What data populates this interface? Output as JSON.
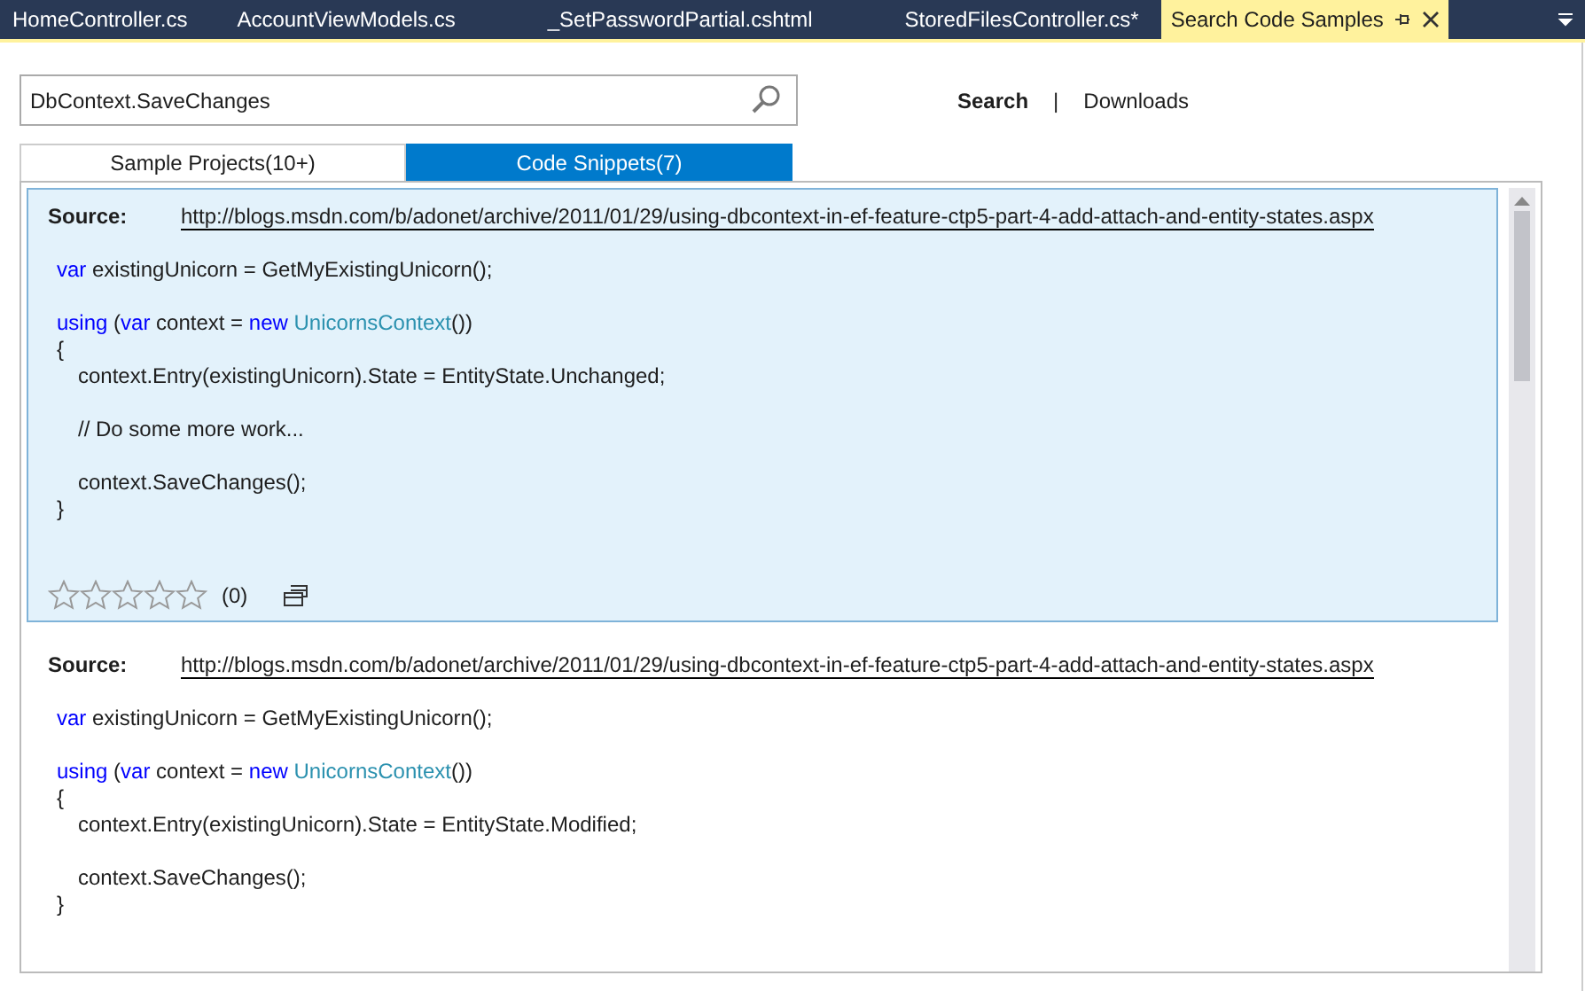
{
  "document_tabs": [
    {
      "label": "HomeController.cs",
      "selected": false
    },
    {
      "label": "AccountViewModels.cs",
      "selected": false
    },
    {
      "label": "_SetPasswordPartial.cshtml",
      "selected": false
    },
    {
      "label": "StoredFilesController.cs*",
      "selected": false
    },
    {
      "label": "Search Code Samples",
      "selected": true
    }
  ],
  "search": {
    "value": "DbContext.SaveChanges"
  },
  "nav_links": [
    {
      "label": "Search",
      "selected": true
    },
    {
      "label": "Downloads",
      "selected": false
    }
  ],
  "nav_separator": "|",
  "result_tabs": [
    {
      "label": "Sample Projects(10+)",
      "selected": false
    },
    {
      "label": "Code Snippets(7)",
      "selected": true
    }
  ],
  "snippets": [
    {
      "selected": true,
      "source_label": "Source:",
      "source_url": "http://blogs.msdn.com/b/adonet/archive/2011/01/29/using-dbcontext-in-ef-feature-ctp5-part-4-add-attach-and-entity-states.aspx",
      "stars": 0,
      "rating_count": "(0)",
      "code_blocks": [
        [
          {
            "tokens": [
              {
                "kind": "keyword",
                "text": "var"
              },
              {
                "kind": "plain",
                "text": " existingUnicorn = GetMyExistingUnicorn();"
              }
            ]
          }
        ],
        [
          {
            "tokens": [
              {
                "kind": "keyword",
                "text": "using"
              },
              {
                "kind": "plain",
                "text": " ("
              },
              {
                "kind": "keyword",
                "text": "var"
              },
              {
                "kind": "plain",
                "text": " context = "
              },
              {
                "kind": "keyword",
                "text": "new "
              },
              {
                "kind": "type",
                "text": "UnicornsContext"
              },
              {
                "kind": "plain",
                "text": "())"
              }
            ]
          },
          {
            "tokens": [
              {
                "kind": "plain",
                "text": "{"
              }
            ],
            "children": [
              [
                {
                  "tokens": [
                    {
                      "kind": "plain",
                      "text": "context.Entry(existingUnicorn).State = EntityState.Unchanged;"
                    }
                  ]
                }
              ],
              [
                {
                  "tokens": [
                    {
                      "kind": "plain",
                      "text": "// Do some more work..."
                    }
                  ]
                }
              ],
              [
                {
                  "tokens": [
                    {
                      "kind": "plain",
                      "text": "context.SaveChanges();"
                    }
                  ]
                }
              ]
            ]
          },
          {
            "tokens": [
              {
                "kind": "plain",
                "text": "}"
              }
            ]
          }
        ]
      ]
    },
    {
      "selected": false,
      "source_label": "Source:",
      "source_url": "http://blogs.msdn.com/b/adonet/archive/2011/01/29/using-dbcontext-in-ef-feature-ctp5-part-4-add-attach-and-entity-states.aspx",
      "code_blocks": [
        [
          {
            "tokens": [
              {
                "kind": "keyword",
                "text": "var"
              },
              {
                "kind": "plain",
                "text": " existingUnicorn = GetMyExistingUnicorn();"
              }
            ]
          }
        ],
        [
          {
            "tokens": [
              {
                "kind": "keyword",
                "text": "using"
              },
              {
                "kind": "plain",
                "text": " ("
              },
              {
                "kind": "keyword",
                "text": "var"
              },
              {
                "kind": "plain",
                "text": " context = "
              },
              {
                "kind": "keyword",
                "text": "new "
              },
              {
                "kind": "type",
                "text": "UnicornsContext"
              },
              {
                "kind": "plain",
                "text": "())"
              }
            ]
          },
          {
            "tokens": [
              {
                "kind": "plain",
                "text": "{"
              }
            ],
            "children": [
              [
                {
                  "tokens": [
                    {
                      "kind": "plain",
                      "text": "context.Entry(existingUnicorn).State = EntityState.Modified;"
                    }
                  ]
                }
              ],
              [
                {
                  "tokens": [
                    {
                      "kind": "plain",
                      "text": "context.SaveChanges();"
                    }
                  ]
                }
              ]
            ]
          },
          {
            "tokens": [
              {
                "kind": "plain",
                "text": "}"
              }
            ]
          }
        ]
      ]
    }
  ]
}
